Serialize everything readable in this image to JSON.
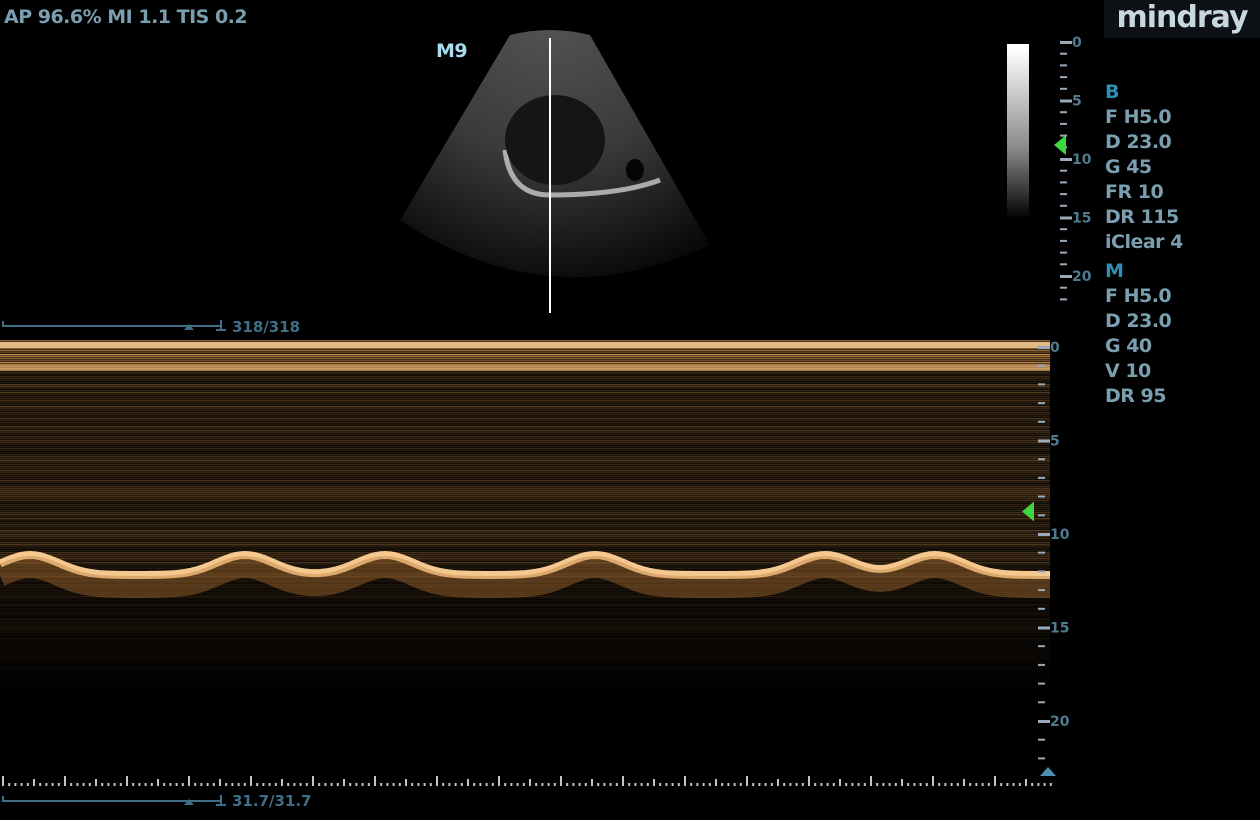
{
  "header": {
    "acoustic": "AP 96.6%  MI 1.1 TIS 0.2",
    "probe_mode": "M9",
    "logo": "mindray"
  },
  "b_params": {
    "title": "B",
    "items": [
      "F H5.0",
      "D 23.0",
      "G 45",
      "FR 10",
      "DR 115",
      "iClear 4"
    ]
  },
  "m_params": {
    "title": "M",
    "items": [
      "F H5.0",
      "D 23.0",
      "G 40",
      "V 10",
      "DR 95"
    ]
  },
  "b_depth_scale": {
    "labels": [
      "0",
      "5",
      "10",
      "15",
      "20"
    ],
    "focus_depth_cm": 8.8
  },
  "m_depth_scale": {
    "labels": [
      "0",
      "5",
      "10",
      "15",
      "20"
    ],
    "focus_depth_cm": 8.8
  },
  "cine_top": {
    "label": "318/318",
    "frame": 318,
    "total": 318
  },
  "cine_bottom": {
    "label": "31.7/31.7"
  },
  "colors": {
    "text": "#7a9fb0",
    "header": "#2f8fb5",
    "focus": "#3dd63d",
    "tint": "#e8a050"
  }
}
